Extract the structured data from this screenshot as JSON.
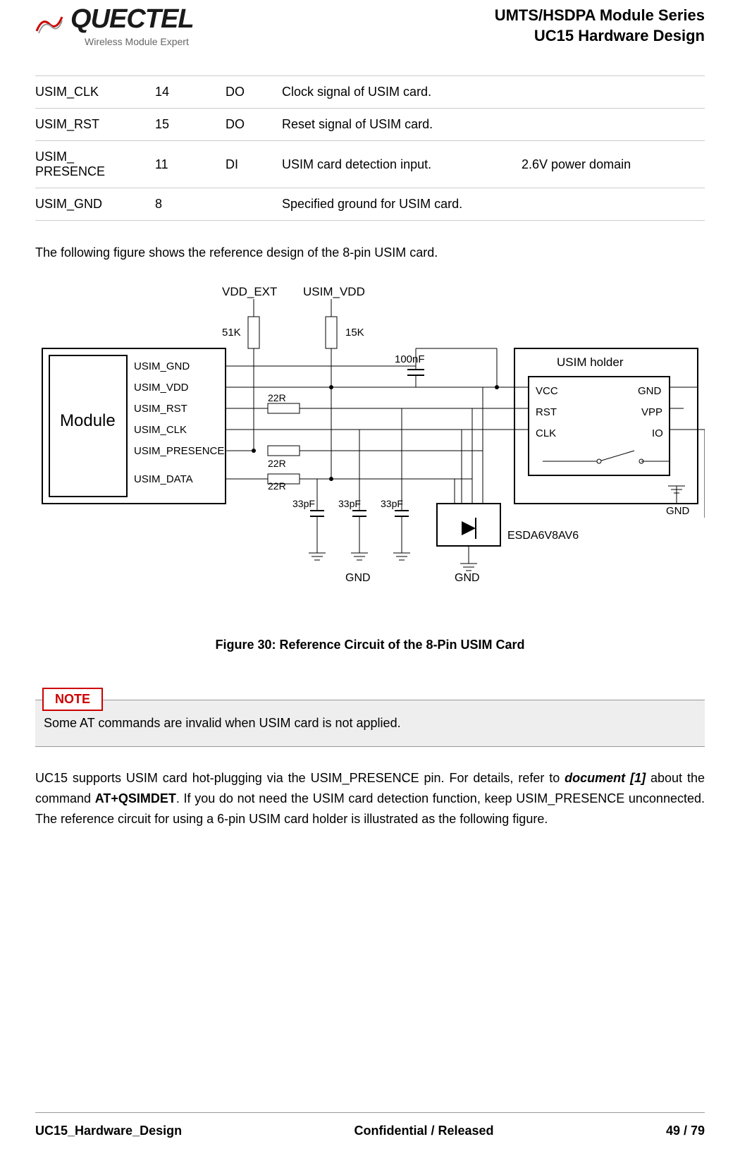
{
  "header": {
    "logo_main": "QUECTEL",
    "logo_sub": "Wireless Module Expert",
    "right_line1": "UMTS/HSDPA Module Series",
    "right_line2": "UC15 Hardware Design"
  },
  "table": {
    "rows": [
      {
        "name": "USIM_CLK",
        "pin": "14",
        "io": "DO",
        "desc": "Clock signal of USIM card.",
        "comment": ""
      },
      {
        "name": "USIM_RST",
        "pin": "15",
        "io": "DO",
        "desc": "Reset signal of USIM card.",
        "comment": ""
      },
      {
        "name": "USIM_ PRESENCE",
        "pin": "11",
        "io": "DI",
        "desc": "USIM card detection input.",
        "comment": "2.6V power domain"
      },
      {
        "name": "USIM_GND",
        "pin": "8",
        "io": "",
        "desc": "Specified ground for USIM card.",
        "comment": ""
      }
    ]
  },
  "intro": "The following figure shows the reference design of the 8-pin USIM card.",
  "diagram": {
    "module": "Module",
    "signals": [
      "USIM_GND",
      "USIM_VDD",
      "USIM_RST",
      "USIM_CLK",
      "USIM_PRESENCE",
      "USIM_DATA"
    ],
    "top_labels": {
      "vdd_ext": "VDD_EXT",
      "usim_vdd": "USIM_VDD"
    },
    "resistors": {
      "r51k": "51K",
      "r15k": "15K",
      "r22r_1": "22R",
      "r22r_2": "22R",
      "r22r_3": "22R"
    },
    "caps": {
      "c100nf": "100nF",
      "c33_1": "33pF",
      "c33_2": "33pF",
      "c33_3": "33pF"
    },
    "holder": {
      "title": "USIM holder",
      "vcc": "VCC",
      "rst": "RST",
      "clk": "CLK",
      "gnd": "GND",
      "vpp": "VPP",
      "io": "IO"
    },
    "gnd": "GND",
    "esd": "ESDA6V8AV6"
  },
  "figure_caption": "Figure 30: Reference Circuit of the 8-Pin USIM Card",
  "note": {
    "tag": "NOTE",
    "text": "Some AT commands are invalid when USIM card is not applied."
  },
  "body": {
    "p1_a": "UC15 supports USIM card hot-plugging via the USIM_PRESENCE pin. For details, refer to ",
    "p1_doc": "document [1]",
    "p1_b": " about the command ",
    "p1_cmd": "AT+QSIMDET",
    "p1_c": ". If you do not need the USIM card detection function, keep USIM_PRESENCE unconnected. The reference circuit for using a 6-pin USIM card holder is illustrated as the following figure."
  },
  "footer": {
    "left": "UC15_Hardware_Design",
    "center": "Confidential / Released",
    "right": "49 / 79"
  }
}
